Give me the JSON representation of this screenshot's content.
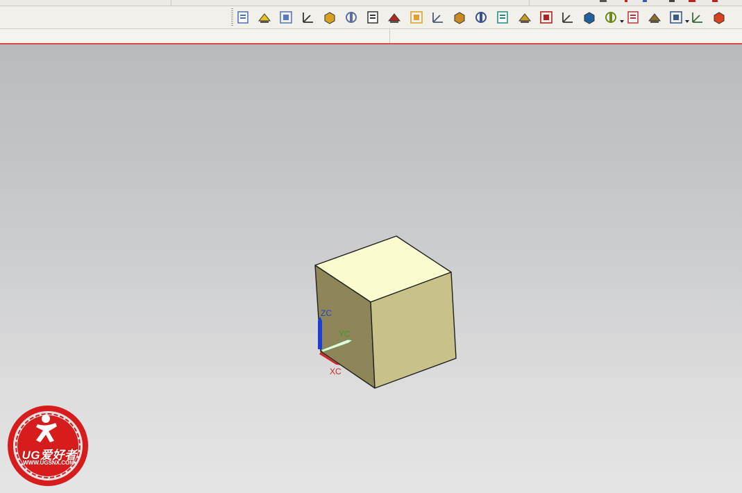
{
  "toolbar": {
    "icons": [
      {
        "name": "part-navigator-icon",
        "color": "#4a6fb0"
      },
      {
        "name": "analyze-icon",
        "color": "#e8c020"
      },
      {
        "name": "feature-icon",
        "color": "#5a7ab8"
      },
      {
        "name": "wcs-icon",
        "color": "#333333"
      },
      {
        "name": "box-icon",
        "color": "#d8a020"
      },
      {
        "name": "face-icon",
        "color": "#5a6f9a"
      },
      {
        "name": "sheet-icon",
        "color": "#333333"
      },
      {
        "name": "tools-icon",
        "color": "#b02a20"
      },
      {
        "name": "layers-icon",
        "color": "#e0a030"
      },
      {
        "name": "window-icon",
        "color": "#4a5a78"
      },
      {
        "name": "dimension-icon",
        "color": "#c88a20"
      },
      {
        "name": "section-icon",
        "color": "#3a4f8a"
      },
      {
        "name": "house-icon",
        "color": "#1d8a7a"
      },
      {
        "name": "roof-icon",
        "color": "#c89a20"
      },
      {
        "name": "clip-icon",
        "color": "#b02020"
      },
      {
        "name": "fit-icon",
        "color": "#3a3a3a"
      },
      {
        "name": "zoom-region-icon",
        "color": "#2060a0"
      },
      {
        "name": "stair-icon",
        "color": "#6a8a20"
      },
      {
        "name": "orient-icon",
        "color": "#c03030"
      },
      {
        "name": "table-icon",
        "color": "#8a7030"
      },
      {
        "name": "display-icon",
        "color": "#3a5a8a"
      },
      {
        "name": "eye-icon",
        "color": "#3a6a3a"
      },
      {
        "name": "refresh-icon",
        "color": "#d84020"
      }
    ]
  },
  "triad": {
    "zc": "ZC",
    "yc": "YC",
    "xc": "XC",
    "colors": {
      "z": "#1c3fd1",
      "y": "#3b9a2c",
      "x": "#d02828"
    }
  },
  "model": {
    "top_color": "#fbfbd0",
    "front_color": "#c9c18a",
    "left_color": "#8e8658",
    "edge_color": "#1e1e1e"
  },
  "watermark": {
    "brand": "UG爱好者",
    "url": "WWW.UGSNX.COM",
    "color": "#d61c1c"
  }
}
